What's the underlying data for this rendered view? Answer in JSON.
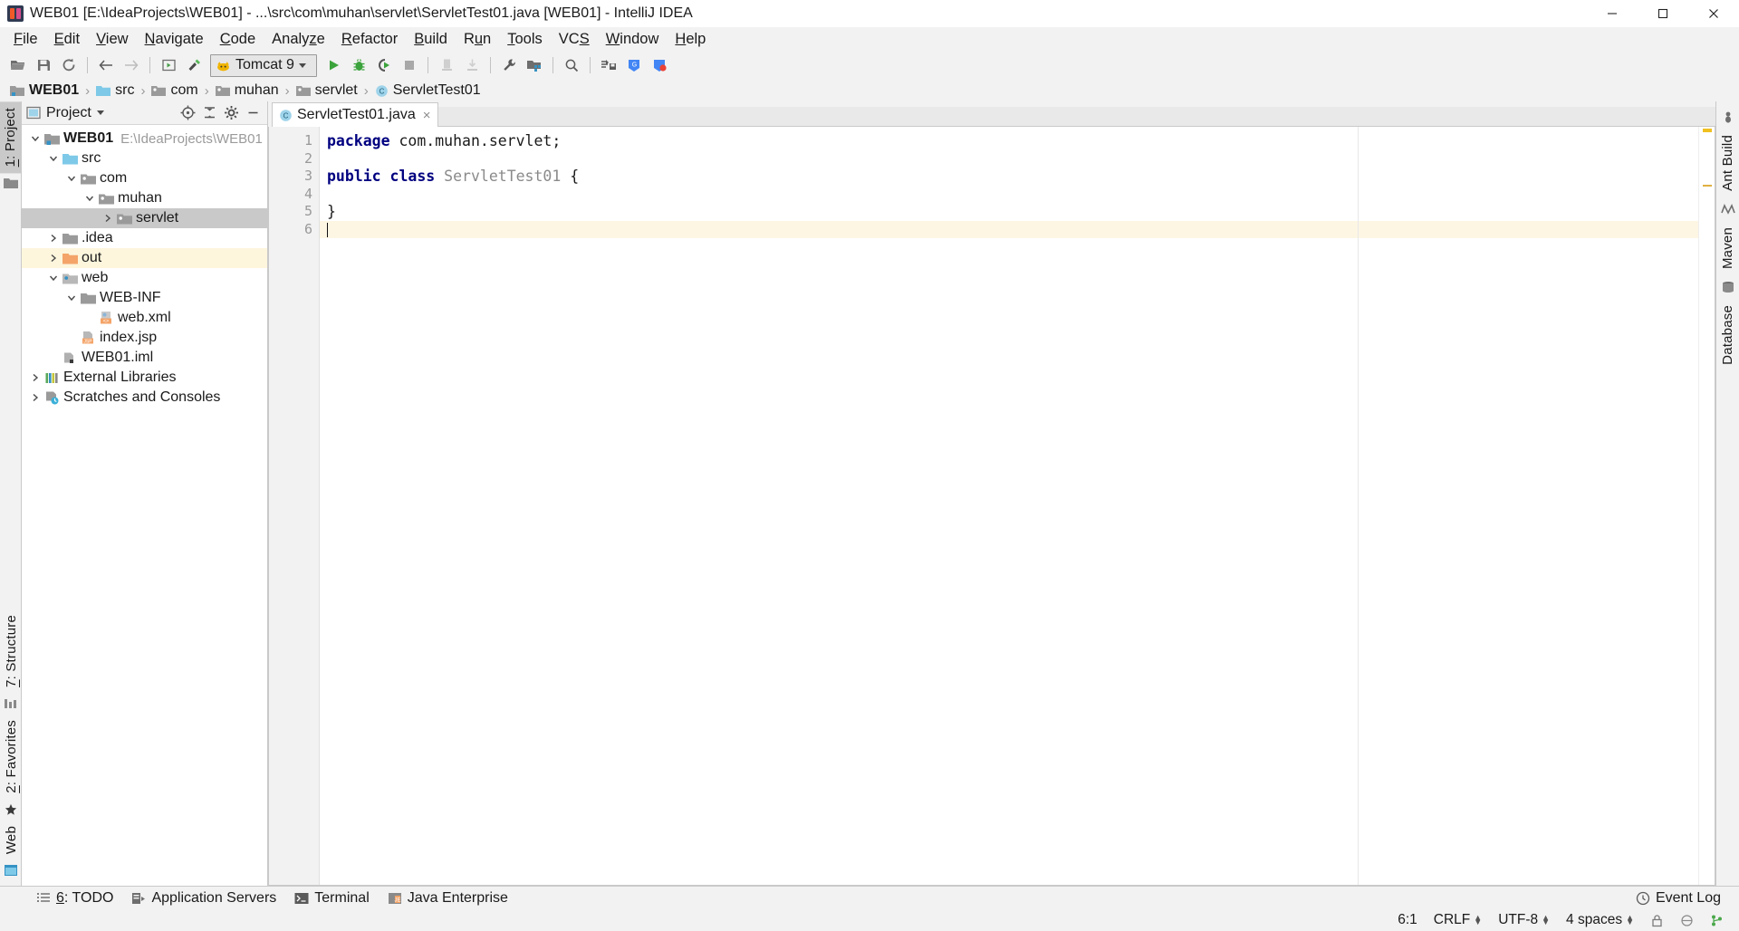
{
  "window": {
    "title": "WEB01 [E:\\IdeaProjects\\WEB01] - ...\\src\\com\\muhan\\servlet\\ServletTest01.java [WEB01] - IntelliJ IDEA",
    "app_icon": "intellij-idea-icon",
    "minimize_label": "Minimize",
    "maximize_label": "Maximize",
    "close_label": "Close"
  },
  "menu": {
    "items": [
      {
        "label": "File",
        "mnemonic": "F"
      },
      {
        "label": "Edit",
        "mnemonic": "E"
      },
      {
        "label": "View",
        "mnemonic": "V"
      },
      {
        "label": "Navigate",
        "mnemonic": "N"
      },
      {
        "label": "Code",
        "mnemonic": "C"
      },
      {
        "label": "Analyze",
        "mnemonic": "z"
      },
      {
        "label": "Refactor",
        "mnemonic": "R"
      },
      {
        "label": "Build",
        "mnemonic": "B"
      },
      {
        "label": "Run",
        "mnemonic": "u"
      },
      {
        "label": "Tools",
        "mnemonic": "T"
      },
      {
        "label": "VCS",
        "mnemonic": "S"
      },
      {
        "label": "Window",
        "mnemonic": "W"
      },
      {
        "label": "Help",
        "mnemonic": "H"
      }
    ]
  },
  "toolbar": {
    "buttons": [
      {
        "name": "open-folder-icon",
        "tooltip": "Open"
      },
      {
        "name": "save-all-icon",
        "tooltip": "Save All"
      },
      {
        "name": "sync-refresh-icon",
        "tooltip": "Synchronize"
      },
      {
        "name": "back-arrow-icon",
        "tooltip": "Back"
      },
      {
        "name": "forward-arrow-icon",
        "tooltip": "Forward"
      },
      {
        "name": "compile-icon",
        "tooltip": "Compile"
      },
      {
        "name": "build-hammer-icon",
        "tooltip": "Build Project"
      },
      {
        "name": "run-icon",
        "tooltip": "Run"
      },
      {
        "name": "debug-icon",
        "tooltip": "Debug"
      },
      {
        "name": "run-coverage-icon",
        "tooltip": "Run with Coverage"
      },
      {
        "name": "stop-icon",
        "tooltip": "Stop"
      },
      {
        "name": "update-app-icon",
        "tooltip": "Update Application"
      },
      {
        "name": "deploy-icon",
        "tooltip": "Deploy"
      },
      {
        "name": "settings-wrench-icon",
        "tooltip": "Settings"
      },
      {
        "name": "project-structure-icon",
        "tooltip": "Project Structure"
      },
      {
        "name": "search-everywhere-icon",
        "tooltip": "Search Everywhere"
      },
      {
        "name": "database-save-icon",
        "tooltip": "Database"
      },
      {
        "name": "google-app-engine-icon",
        "tooltip": "Google App Engine"
      },
      {
        "name": "google-deploy-icon",
        "tooltip": "Google Deploy"
      }
    ],
    "run_config": {
      "label": "Tomcat 9",
      "icon": "tomcat-icon"
    }
  },
  "breadcrumb": {
    "items": [
      {
        "label": "WEB01",
        "icon": "module-icon",
        "bold": true
      },
      {
        "label": "src",
        "icon": "source-folder-icon",
        "bold": false
      },
      {
        "label": "com",
        "icon": "package-icon",
        "bold": false
      },
      {
        "label": "muhan",
        "icon": "package-icon",
        "bold": false
      },
      {
        "label": "servlet",
        "icon": "package-icon",
        "bold": false
      },
      {
        "label": "ServletTest01",
        "icon": "class-icon",
        "bold": false
      }
    ],
    "separator": "›"
  },
  "left_strip": {
    "tabs": [
      {
        "label": "1: Project",
        "mnemonic": "1",
        "selected": true
      },
      {
        "label": "7: Structure",
        "mnemonic": "7",
        "selected": false
      },
      {
        "label": "2: Favorites",
        "mnemonic": "2",
        "selected": false
      },
      {
        "label": "Web",
        "mnemonic": "",
        "selected": false
      }
    ],
    "icons": [
      "project-folder-icon",
      "structure-icon",
      "favorites-star-icon",
      "web-icon"
    ]
  },
  "right_strip": {
    "tabs": [
      {
        "label": "Ant Build",
        "icon": "ant-icon"
      },
      {
        "label": "Maven",
        "icon": "maven-icon"
      },
      {
        "label": "Database",
        "icon": "database-icon"
      }
    ]
  },
  "project_panel": {
    "title": "Project",
    "actions": [
      {
        "name": "scroll-from-source-icon",
        "tooltip": "Select Opened File"
      },
      {
        "name": "collapse-all-icon",
        "tooltip": "Collapse All"
      },
      {
        "name": "settings-gear-icon",
        "tooltip": "Settings"
      },
      {
        "name": "hide-panel-icon",
        "tooltip": "Hide"
      }
    ],
    "tree": [
      {
        "label": "WEB01",
        "path": "E:\\IdeaProjects\\WEB01",
        "icon": "module-icon",
        "indent": 0,
        "twist": "expanded",
        "bold": true,
        "state": "normal"
      },
      {
        "label": "src",
        "path": "",
        "icon": "source-folder-icon",
        "indent": 1,
        "twist": "expanded",
        "bold": false,
        "state": "normal"
      },
      {
        "label": "com",
        "path": "",
        "icon": "package-icon",
        "indent": 2,
        "twist": "expanded",
        "bold": false,
        "state": "normal"
      },
      {
        "label": "muhan",
        "path": "",
        "icon": "package-icon",
        "indent": 3,
        "twist": "expanded",
        "bold": false,
        "state": "normal"
      },
      {
        "label": "servlet",
        "path": "",
        "icon": "package-icon",
        "indent": 4,
        "twist": "collapsed",
        "bold": false,
        "state": "selected"
      },
      {
        "label": ".idea",
        "path": "",
        "icon": "folder-icon",
        "indent": 1,
        "twist": "collapsed",
        "bold": false,
        "state": "normal"
      },
      {
        "label": "out",
        "path": "",
        "icon": "excluded-folder-icon",
        "indent": 1,
        "twist": "collapsed",
        "bold": false,
        "state": "highlight"
      },
      {
        "label": "web",
        "path": "",
        "icon": "web-folder-icon",
        "indent": 1,
        "twist": "expanded",
        "bold": false,
        "state": "normal"
      },
      {
        "label": "WEB-INF",
        "path": "",
        "icon": "folder-icon",
        "indent": 2,
        "twist": "expanded",
        "bold": false,
        "state": "normal"
      },
      {
        "label": "web.xml",
        "path": "",
        "icon": "xml-file-icon",
        "indent": 3,
        "twist": "none",
        "bold": false,
        "state": "normal"
      },
      {
        "label": "index.jsp",
        "path": "",
        "icon": "jsp-file-icon",
        "indent": 2,
        "twist": "none",
        "bold": false,
        "state": "normal"
      },
      {
        "label": "WEB01.iml",
        "path": "",
        "icon": "iml-file-icon",
        "indent": 1,
        "twist": "none",
        "bold": false,
        "state": "normal"
      },
      {
        "label": "External Libraries",
        "path": "",
        "icon": "libraries-icon",
        "indent": 0,
        "twist": "collapsed",
        "bold": false,
        "state": "normal"
      },
      {
        "label": "Scratches and Consoles",
        "path": "",
        "icon": "scratches-icon",
        "indent": 0,
        "twist": "collapsed",
        "bold": false,
        "state": "normal"
      }
    ]
  },
  "editor": {
    "tab": {
      "label": "ServletTest01.java",
      "icon": "java-class-icon",
      "close": "×"
    },
    "line_numbers": [
      "1",
      "2",
      "3",
      "4",
      "5",
      "6"
    ],
    "code_lines": [
      {
        "n": 1,
        "tokens": [
          {
            "t": "package",
            "c": "kw"
          },
          {
            "t": " com.muhan.servlet;",
            "c": ""
          }
        ],
        "caret": false
      },
      {
        "n": 2,
        "tokens": [],
        "caret": false
      },
      {
        "n": 3,
        "tokens": [
          {
            "t": "public",
            "c": "kw"
          },
          {
            "t": " ",
            "c": ""
          },
          {
            "t": "class",
            "c": "kw"
          },
          {
            "t": " ",
            "c": ""
          },
          {
            "t": "ServletTest01",
            "c": "cls"
          },
          {
            "t": " {",
            "c": ""
          }
        ],
        "caret": false
      },
      {
        "n": 4,
        "tokens": [],
        "caret": false
      },
      {
        "n": 5,
        "tokens": [
          {
            "t": "}",
            "c": ""
          }
        ],
        "caret": false
      },
      {
        "n": 6,
        "tokens": [],
        "caret": true
      }
    ]
  },
  "bottom_bar": {
    "tools": [
      {
        "label": "6: TODO",
        "mnemonic": "6",
        "icon": "todo-icon"
      },
      {
        "label": "Application Servers",
        "mnemonic": "",
        "icon": "app-servers-icon"
      },
      {
        "label": "Terminal",
        "mnemonic": "",
        "icon": "terminal-icon"
      },
      {
        "label": "Java Enterprise",
        "mnemonic": "",
        "icon": "java-enterprise-icon"
      }
    ],
    "event_log": {
      "label": "Event Log",
      "icon": "event-log-icon"
    }
  },
  "status_bar": {
    "caret_position": "6:1",
    "line_separator": "CRLF",
    "encoding": "UTF-8",
    "indent": "4 spaces",
    "lock_icon": "lock-icon",
    "gap_icon": "gap-icon",
    "git_icon": "git-branch-icon"
  },
  "colors": {
    "accent_blue": "#3592c4",
    "keyword": "#000080",
    "highlight_yellow": "#fdf6dd",
    "selection_gray": "#c9c9c9",
    "orange_folder": "#f4a469",
    "green_run": "#4caf50",
    "panel_bg": "#f2f2f2"
  }
}
